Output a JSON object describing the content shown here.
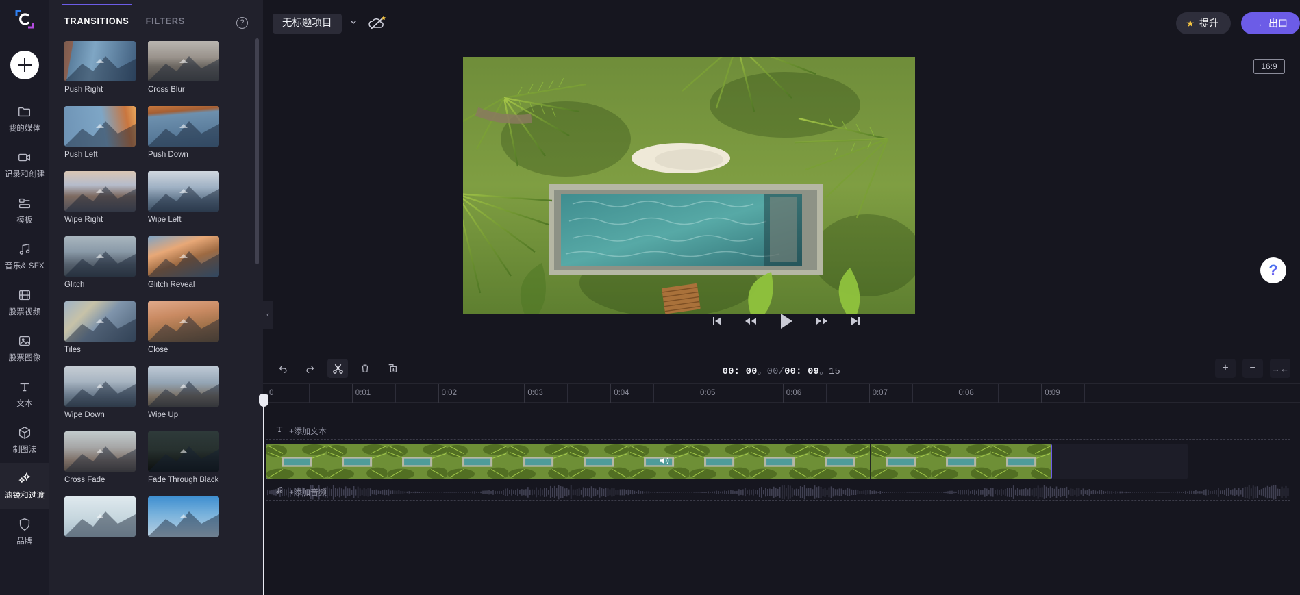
{
  "app": {
    "name": "clipchamp-video-editor",
    "accent": "#6c5ce7"
  },
  "rail": {
    "add_label": "+",
    "items": [
      {
        "label": "我的媒体",
        "icon": "folder-icon",
        "active": false
      },
      {
        "label": "记录和创建",
        "icon": "video-camera-icon",
        "active": false
      },
      {
        "label": "模板",
        "icon": "templates-icon",
        "active": false
      },
      {
        "label": "音乐& SFX",
        "icon": "music-note-icon",
        "active": false
      },
      {
        "label": "股票视频",
        "icon": "film-strip-icon",
        "active": false
      },
      {
        "label": "股票图像",
        "icon": "image-icon",
        "active": false
      },
      {
        "label": "文本",
        "icon": "text-t-icon",
        "active": false
      },
      {
        "label": "制图法",
        "icon": "cube-icon",
        "active": false
      },
      {
        "label": "滤镜和过渡",
        "icon": "sparkles-icon",
        "active": true
      },
      {
        "label": "品牌",
        "icon": "shield-icon",
        "active": false
      }
    ]
  },
  "panel": {
    "tabs": [
      {
        "label": "TRANSITIONS",
        "active": true
      },
      {
        "label": "FILTERS",
        "active": false
      }
    ],
    "help_glyph": "?",
    "collapse_glyph": "‹",
    "items": [
      {
        "label": "Push Right",
        "g": "linear-gradient(100deg,#7d5b4d 0%,#8a6152 11%,#5b7f9e 12%,#7fa6c4 40%,#3f5d7d 100%)"
      },
      {
        "label": "Cross Blur",
        "g": "linear-gradient(180deg,#b9b5b0 0%,#9a938c 40%,#6d6862 62%,#4d4a47 100%)"
      },
      {
        "label": "Push Left",
        "g": "linear-gradient(80deg,#6e93b5 0%,#7ea6c6 55%,#c9763f 86%,#e8a65c 100%)"
      },
      {
        "label": "Push Down",
        "g": "linear-gradient(175deg,#c8773c 0%,#a35e34 16%,#6d90ae 24%,#4b6c8c 100%)"
      },
      {
        "label": "Wipe Right",
        "g": "linear-gradient(180deg,#d9c6b4 0%,#b6bccb 34%,#7d6a60 62%,#4d4d57 100%)"
      },
      {
        "label": "Wipe Left",
        "g": "linear-gradient(180deg,#cfd6de 0%,#9fb1c4 40%,#64798e 70%,#3f5064 100%)"
      },
      {
        "label": "Glitch",
        "g": "linear-gradient(180deg,#a9b6bf 0%,#8a9aa8 38%,#55606d 70%,#39424c 100%)"
      },
      {
        "label": "Glitch Reveal",
        "g": "linear-gradient(160deg,#7fa3c4 0%,#e8a877 32%,#9d6a42 58%,#4a6a8a 100%)"
      },
      {
        "label": "Tiles",
        "g": "linear-gradient(135deg,#9fb3c6 0%,#c7c2a8 28%,#7f94ab 52%,#4b6076 100%)"
      },
      {
        "label": "Close",
        "g": "linear-gradient(170deg,#e0a98a 0%,#c98a62 35%,#9a6e46 70%,#6e5436 100%)"
      },
      {
        "label": "Wipe Down",
        "g": "linear-gradient(180deg,#c6cdd4 0%,#a8b5c2 38%,#6d7d8e 70%,#44525f 100%)"
      },
      {
        "label": "Wipe Up",
        "g": "linear-gradient(180deg,#bfcad6 0%,#93a4b4 42%,#7a6f63 74%,#4f4a43 100%)"
      },
      {
        "label": "Cross Fade",
        "g": "linear-gradient(180deg,#c2cbcd 0%,#a6a6a6 40%,#7d6f67 72%,#4f4742 100%)"
      },
      {
        "label": "Fade Through Black",
        "g": "linear-gradient(180deg,#2e3a3a 0%,#27312f 45%,#151a19 80%,#0d100f 100%)"
      },
      {
        "label": "",
        "g": "linear-gradient(180deg,#dfe9ee 0%,#c6d6de 55%,#a8bcc8 100%)"
      },
      {
        "label": "",
        "g": "linear-gradient(180deg,#3f8fd0 0%,#79b2dc 45%,#b9cfe0 100%)"
      }
    ]
  },
  "topbar": {
    "project_name": "无标题项目",
    "caret_glyph": "⌄",
    "cloud_icon": "cloud-offline-star-icon",
    "upgrade_label": "提升",
    "upgrade_icon": "star-icon",
    "export_label": "出口",
    "export_icon": "arrow-right-icon"
  },
  "stage": {
    "ratio_label": "16:9",
    "help_glyph": "?",
    "controls": [
      {
        "name": "skip-to-start-button",
        "icon": "skip-start-icon"
      },
      {
        "name": "rewind-button",
        "icon": "rewind-icon"
      },
      {
        "name": "play-button",
        "icon": "play-icon"
      },
      {
        "name": "fast-forward-button",
        "icon": "fast-forward-icon"
      },
      {
        "name": "skip-to-end-button",
        "icon": "skip-end-icon"
      }
    ]
  },
  "timeline": {
    "tools": [
      {
        "name": "undo-button",
        "icon": "undo-icon",
        "active": false
      },
      {
        "name": "redo-button",
        "icon": "redo-icon",
        "active": false
      },
      {
        "name": "split-button",
        "icon": "scissors-icon",
        "active": true
      },
      {
        "name": "delete-button",
        "icon": "trash-icon",
        "active": false
      },
      {
        "name": "duplicate-button",
        "icon": "duplicate-icon",
        "active": false
      }
    ],
    "timecode": {
      "current": "00: 00",
      "current_frames": "00",
      "separator": "/",
      "total": "00: 09",
      "total_frames": "15",
      "dot": "。"
    },
    "zoom_in_label": "+",
    "zoom_out_label": "−",
    "fit_label": "→←",
    "ruler_labels": [
      "0",
      "0:01",
      "0:02",
      "0:03",
      "0:04",
      "0:05",
      "0:06",
      "0:07",
      "0:08",
      "0:09"
    ],
    "text_track": {
      "icon": "text-t-icon",
      "placeholder": "+添加文本"
    },
    "audio_track": {
      "icon": "music-note-icon",
      "placeholder": "+添加音频"
    },
    "clip": {
      "name": "video-clip",
      "mute_icon": "speaker-icon"
    }
  }
}
